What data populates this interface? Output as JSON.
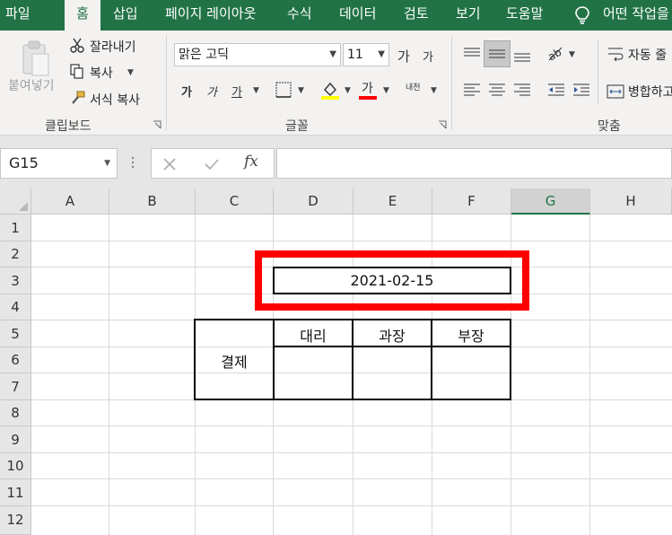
{
  "tabs": [
    "파일",
    "홈",
    "삽입",
    "페이지 레이아웃",
    "수식",
    "데이터",
    "검토",
    "보기",
    "도움말",
    "어떤 작업을"
  ],
  "ribbon": {
    "clipboard": {
      "paste": "붙여넣기",
      "cut": "잘라내기",
      "copy": "복사",
      "format_painter": "서식 복사",
      "label": "클립보드"
    },
    "font": {
      "name": "맑은 고딕",
      "size": "11",
      "grow": "가",
      "shrink": "가",
      "bold": "가",
      "italic": "가",
      "underline": "가",
      "font_color": "가",
      "phonetic": "내천",
      "label": "글꼴"
    },
    "alignment": {
      "wrap": "자동 줄",
      "merge": "병합하고",
      "label": "맞춤"
    }
  },
  "formula_bar": {
    "name_box": "G15",
    "fx": "fx",
    "value": ""
  },
  "columns": [
    "A",
    "B",
    "C",
    "D",
    "E",
    "F",
    "G",
    "H"
  ],
  "selected_column": "G",
  "rows": [
    "1",
    "2",
    "3",
    "4",
    "5",
    "6",
    "7",
    "8",
    "9",
    "10",
    "11",
    "12"
  ],
  "cells": {
    "date": "2021-02-15",
    "approval": "결제",
    "deputy": "대리",
    "manager": "과장",
    "director": "부장"
  },
  "colors": {
    "excel_green": "#217346",
    "highlight": "#ff0000"
  }
}
